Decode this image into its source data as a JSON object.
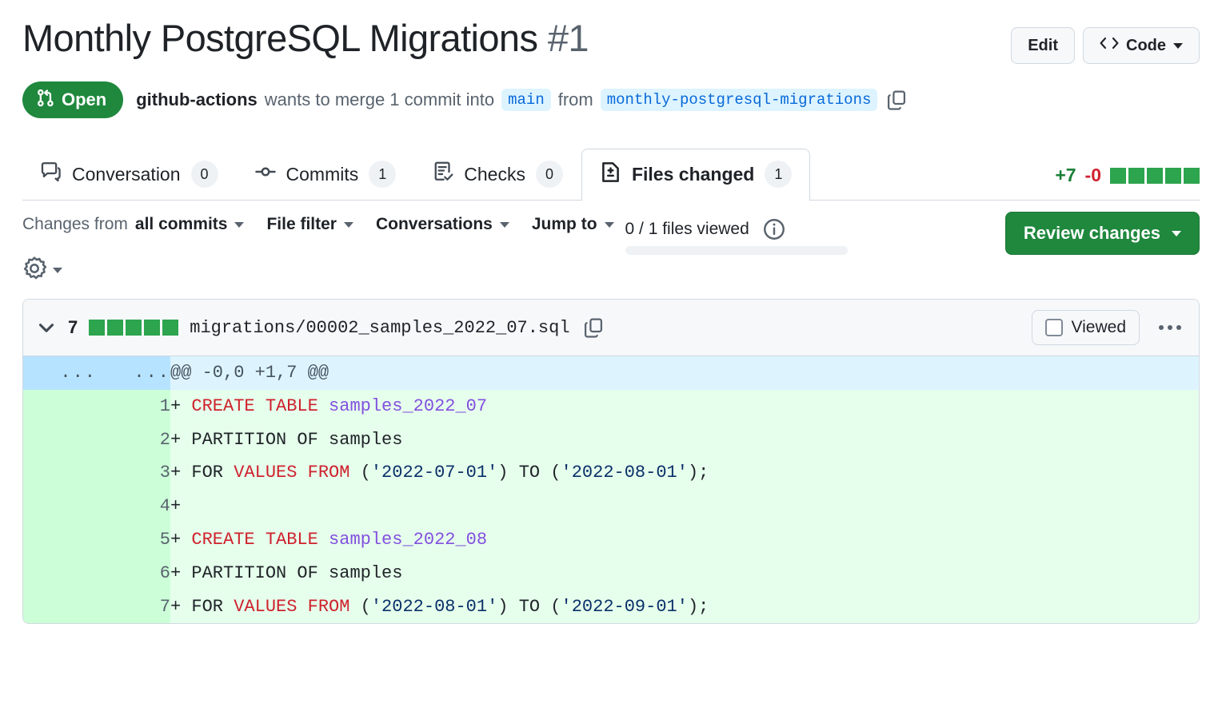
{
  "header": {
    "title": "Monthly PostgreSQL Migrations",
    "number": "#1",
    "edit_label": "Edit",
    "code_label": "Code",
    "code_icon": "code-brackets-icon",
    "edit_icon": "edit-icon"
  },
  "state": {
    "badge_label": "Open",
    "badge_icon": "git-pull-request-icon",
    "badge_color": "#1f883d",
    "author": "github-actions",
    "text_before": "wants to merge 1 commit into",
    "base_branch": "main",
    "text_middle": "from",
    "head_branch": "monthly-postgresql-migrations",
    "copy_icon": "copy-icon"
  },
  "tabs": [
    {
      "label": "Conversation",
      "count": "0",
      "icon": "comment-discussion-icon",
      "active": false
    },
    {
      "label": "Commits",
      "count": "1",
      "icon": "git-commit-icon",
      "active": false
    },
    {
      "label": "Checks",
      "count": "0",
      "icon": "checklist-icon",
      "active": false
    },
    {
      "label": "Files changed",
      "count": "1",
      "icon": "file-diff-icon",
      "active": true
    }
  ],
  "diffstat": {
    "additions": "+7",
    "deletions": "-0",
    "blocks": [
      "add",
      "add",
      "add",
      "add",
      "add"
    ],
    "add_color": "#2da44e",
    "additions_color": "#1a7f37",
    "deletions_color": "#cf222e"
  },
  "toolbar": {
    "changes_from_prefix": "Changes from",
    "changes_from_value": "all commits",
    "file_filter": "File filter",
    "conversations": "Conversations",
    "jump_to": "Jump to",
    "files_viewed": "0 / 1 files viewed",
    "info_icon": "info-icon",
    "gear_icon": "gear-icon",
    "review_label": "Review changes",
    "review_color": "#1f883d",
    "progress_percent": 0
  },
  "file": {
    "change_count": "7",
    "blocks": [
      "add",
      "add",
      "add",
      "add",
      "add"
    ],
    "path": "migrations/00002_samples_2022_07.sql",
    "copy_icon": "copy-icon",
    "chevron_icon": "chevron-down-icon",
    "viewed_label": "Viewed",
    "viewed_checked": false,
    "kebab_icon": "kebab-menu-icon"
  },
  "diff": {
    "hunk": {
      "old_ln": "...",
      "new_ln": "...",
      "header": "@@ -0,0 +1,7 @@"
    },
    "lines": [
      {
        "n": "1",
        "sign": "+",
        "tokens": [
          {
            "t": "CREATE TABLE ",
            "c": "kw"
          },
          {
            "t": "samples_2022_07",
            "c": "ent"
          }
        ]
      },
      {
        "n": "2",
        "sign": "+",
        "tokens": [
          {
            "t": "PARTITION OF samples",
            "c": ""
          }
        ]
      },
      {
        "n": "3",
        "sign": "+",
        "tokens": [
          {
            "t": "FOR ",
            "c": ""
          },
          {
            "t": "VALUES FROM",
            "c": "kw"
          },
          {
            "t": " (",
            "c": ""
          },
          {
            "t": "'2022-07-01'",
            "c": "str"
          },
          {
            "t": ") TO (",
            "c": ""
          },
          {
            "t": "'2022-08-01'",
            "c": "str"
          },
          {
            "t": ");",
            "c": ""
          }
        ]
      },
      {
        "n": "4",
        "sign": "+",
        "tokens": [
          {
            "t": "",
            "c": ""
          }
        ]
      },
      {
        "n": "5",
        "sign": "+",
        "tokens": [
          {
            "t": "CREATE TABLE ",
            "c": "kw"
          },
          {
            "t": "samples_2022_08",
            "c": "ent"
          }
        ]
      },
      {
        "n": "6",
        "sign": "+",
        "tokens": [
          {
            "t": "PARTITION OF samples",
            "c": ""
          }
        ]
      },
      {
        "n": "7",
        "sign": "+",
        "tokens": [
          {
            "t": "FOR ",
            "c": ""
          },
          {
            "t": "VALUES FROM",
            "c": "kw"
          },
          {
            "t": " (",
            "c": ""
          },
          {
            "t": "'2022-08-01'",
            "c": "str"
          },
          {
            "t": ") TO (",
            "c": ""
          },
          {
            "t": "'2022-09-01'",
            "c": "str"
          },
          {
            "t": ");",
            "c": ""
          }
        ]
      }
    ]
  }
}
